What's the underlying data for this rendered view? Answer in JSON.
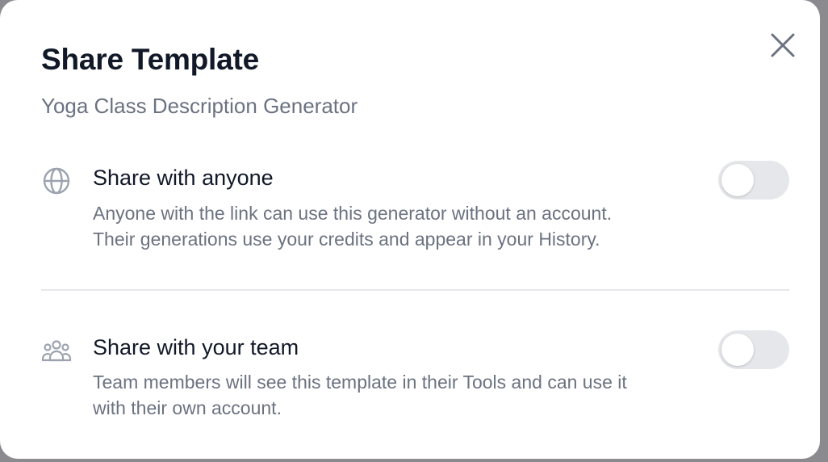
{
  "dialog": {
    "title": "Share Template",
    "subtitle": "Yoga Class Description Generator",
    "close_icon": "close-icon"
  },
  "options": [
    {
      "icon": "globe-icon",
      "title": "Share with anyone",
      "description_line1": "Anyone with the link can use this generator without an account.",
      "description_line2": "Their generations use your credits and appear in your History.",
      "enabled": false
    },
    {
      "icon": "users-icon",
      "title": "Share with your team",
      "description_line1": "Team members will see this template in their Tools and can use it",
      "description_line2": "with their own account.",
      "enabled": false
    }
  ],
  "colors": {
    "title": "#111827",
    "muted_text": "#6b7280",
    "icon": "#9ca3af",
    "toggle_off": "#e5e7eb",
    "divider": "#e5e7eb"
  }
}
